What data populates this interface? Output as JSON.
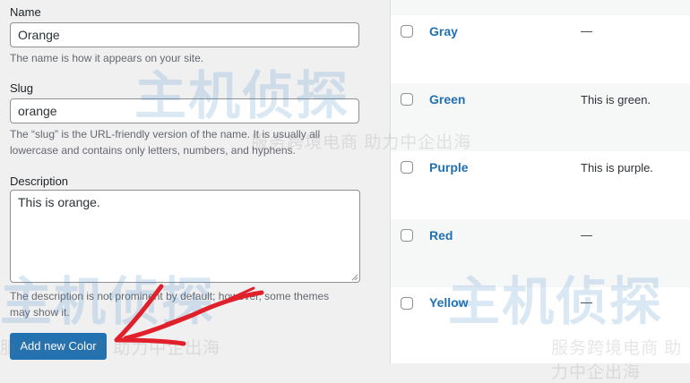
{
  "form": {
    "name_label": "Name",
    "name_value": "Orange",
    "name_help": "The name is how it appears on your site.",
    "slug_label": "Slug",
    "slug_value": "orange",
    "slug_help": "The “slug” is the URL-friendly version of the name. It is usually all lowercase and contains only letters, numbers, and hyphens.",
    "description_label": "Description",
    "description_value": "This is orange.",
    "description_help": "The description is not prominent by default; however, some themes may show it.",
    "submit_label": "Add new Color"
  },
  "table": {
    "rows": [
      {
        "name": "Gray",
        "description": "—"
      },
      {
        "name": "Green",
        "description": "This is green."
      },
      {
        "name": "Purple",
        "description": "This is purple."
      },
      {
        "name": "Red",
        "description": "—"
      },
      {
        "name": "Yellow",
        "description": "—"
      }
    ]
  },
  "watermark": {
    "title": "主机侦探",
    "subtitle": "服务跨境电商 助力中企出海"
  },
  "colors": {
    "accent": "#2271b1",
    "annotation_arrow": "#e0202a",
    "page_bg": "#f0f0f1"
  },
  "icons": [
    "checkbox-icon",
    "resize-grip-icon",
    "annotation-arrow-icon"
  ]
}
